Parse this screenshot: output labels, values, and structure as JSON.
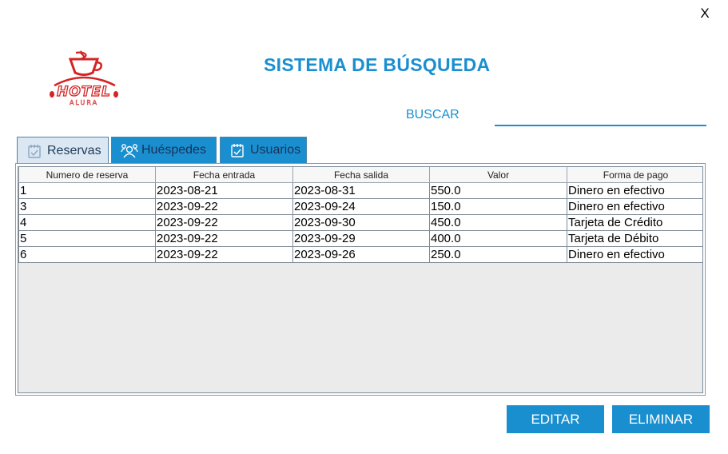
{
  "window": {
    "close_label": "X"
  },
  "logo": {
    "name": "hotel-alura-logo",
    "brand_text": "HOTEL",
    "sub_text": "ALURA"
  },
  "header": {
    "title": "SISTEMA DE BÚSQUEDA"
  },
  "search": {
    "label": "BUSCAR",
    "value": "",
    "placeholder": ""
  },
  "tabs": [
    {
      "label": "Reservas",
      "icon": "calendar-icon",
      "selected": true
    },
    {
      "label": "Huéspedes",
      "icon": "guests-icon",
      "selected": false
    },
    {
      "label": "Usuarios",
      "icon": "users-calendar-icon",
      "selected": false
    }
  ],
  "table": {
    "columns": [
      "Numero de reserva",
      "Fecha entrada",
      "Fecha salida",
      "Valor",
      "Forma de pago"
    ],
    "rows": [
      [
        "1",
        "2023-08-21",
        "2023-08-31",
        "550.0",
        "Dinero en efectivo"
      ],
      [
        "3",
        "2023-09-22",
        "2023-09-24",
        "150.0",
        "Dinero en efectivo"
      ],
      [
        "4",
        "2023-09-22",
        "2023-09-30",
        "450.0",
        "Tarjeta de Crédito"
      ],
      [
        "5",
        "2023-09-22",
        "2023-09-29",
        "400.0",
        "Tarjeta de Débito"
      ],
      [
        "6",
        "2023-09-22",
        "2023-09-26",
        "250.0",
        "Dinero en efectivo"
      ]
    ]
  },
  "actions": {
    "edit_label": "EDITAR",
    "delete_label": "ELIMINAR"
  },
  "colors": {
    "accent": "#1a8fd0",
    "logo_red": "#d42424",
    "selected_tab": "#dbe7f3"
  }
}
